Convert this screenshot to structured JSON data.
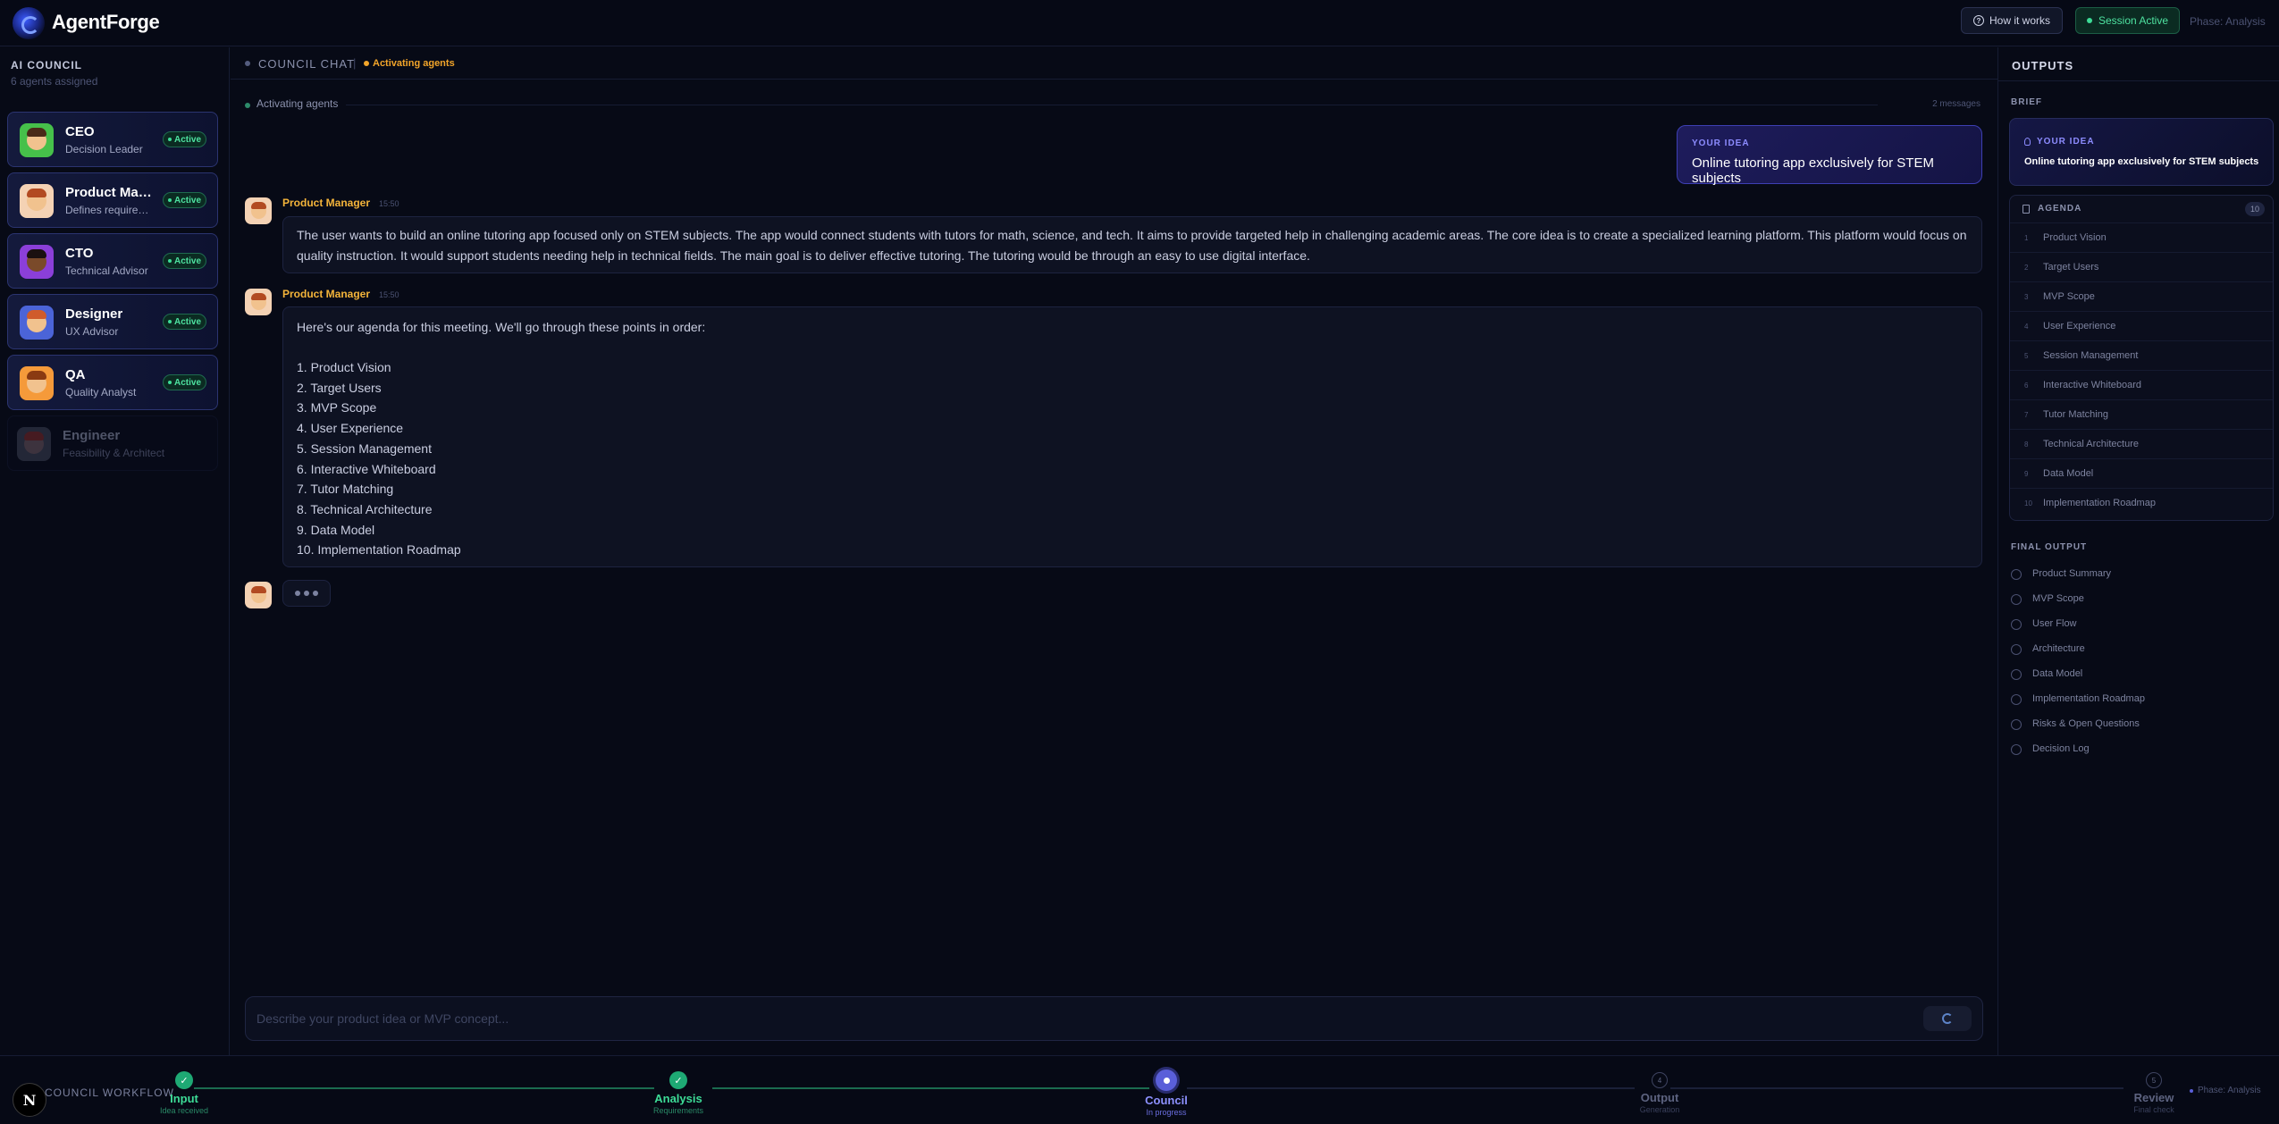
{
  "header": {
    "brand": "AgentForge",
    "how_it_works": "How it works",
    "session_status": "Session Active",
    "phase": "Phase: Analysis"
  },
  "council": {
    "title": "AI COUNCIL",
    "subtitle": "6 agents assigned",
    "active_label": "Active",
    "agents": [
      {
        "name": "CEO",
        "role": "Decision Leader",
        "active": true
      },
      {
        "name": "Product Manager",
        "role": "Defines requirements",
        "active": true
      },
      {
        "name": "CTO",
        "role": "Technical Advisor",
        "active": true
      },
      {
        "name": "Designer",
        "role": "UX Advisor",
        "active": true
      },
      {
        "name": "QA",
        "role": "Quality Analyst",
        "active": true
      },
      {
        "name": "Engineer",
        "role": "Feasibility & Architect",
        "active": false
      }
    ]
  },
  "chat": {
    "title": "COUNCIL CHAT",
    "separator": "|",
    "status": "Activating agents",
    "system_event": "Activating agents",
    "message_count": "2 messages",
    "user_idea_label": "YOUR IDEA",
    "user_idea_text": "Online tutoring app exclusively for STEM subjects",
    "messages": [
      {
        "author": "Product Manager",
        "time": "15:50",
        "text": "The user wants to build an online tutoring app focused only on STEM subjects. The app would connect students with tutors for math, science, and tech. It aims to provide targeted help in challenging academic areas. The core idea is to create a specialized learning platform. This platform would focus on quality instruction. It would support students needing help in technical fields. The main goal is to deliver effective tutoring. The tutoring would be through an easy to use digital interface."
      },
      {
        "author": "Product Manager",
        "time": "15:50",
        "intro": "Here's our agenda for this meeting. We'll go through these points in order:",
        "list": [
          "1. Product Vision",
          "2. Target Users",
          "3. MVP Scope",
          "4. User Experience",
          "5. Session Management",
          "6. Interactive Whiteboard",
          "7. Tutor Matching",
          "8. Technical Architecture",
          "9. Data Model",
          "10. Implementation Roadmap"
        ]
      }
    ],
    "input_placeholder": "Describe your product idea or MVP concept..."
  },
  "outputs": {
    "title": "OUTPUTS",
    "brief_label": "BRIEF",
    "idea_label": "YOUR IDEA",
    "idea_text": "Online tutoring app exclusively for STEM subjects",
    "agenda_label": "AGENDA",
    "agenda_count": "10",
    "agenda": [
      {
        "num": "1",
        "label": "Product Vision"
      },
      {
        "num": "2",
        "label": "Target Users"
      },
      {
        "num": "3",
        "label": "MVP Scope"
      },
      {
        "num": "4",
        "label": "User Experience"
      },
      {
        "num": "5",
        "label": "Session Management"
      },
      {
        "num": "6",
        "label": "Interactive Whiteboard"
      },
      {
        "num": "7",
        "label": "Tutor Matching"
      },
      {
        "num": "8",
        "label": "Technical Architecture"
      },
      {
        "num": "9",
        "label": "Data Model"
      },
      {
        "num": "10",
        "label": "Implementation Roadmap"
      }
    ],
    "final_label": "FINAL OUTPUT",
    "final": [
      "Product Summary",
      "MVP Scope",
      "User Flow",
      "Architecture",
      "Data Model",
      "Implementation Roadmap",
      "Risks & Open Questions",
      "Decision Log"
    ]
  },
  "workflow": {
    "title": "COUNCIL WORKFLOW",
    "badge": "N",
    "phase": "Phase: Analysis",
    "steps": [
      {
        "label": "Input",
        "sub": "Idea received",
        "state": "done",
        "marker": "✓"
      },
      {
        "label": "Analysis",
        "sub": "Requirements",
        "state": "done",
        "marker": "✓"
      },
      {
        "label": "Council",
        "sub": "In progress",
        "state": "current",
        "marker": ""
      },
      {
        "label": "Output",
        "sub": "Generation",
        "state": "pending",
        "marker": "4"
      },
      {
        "label": "Review",
        "sub": "Final check",
        "state": "pending",
        "marker": "5"
      }
    ]
  },
  "colors": {
    "background": "#070a16",
    "accent_green": "#3ddc97",
    "accent_amber": "#f2a52a",
    "accent_indigo": "#5a5fd9",
    "author": "#f4b43a"
  }
}
